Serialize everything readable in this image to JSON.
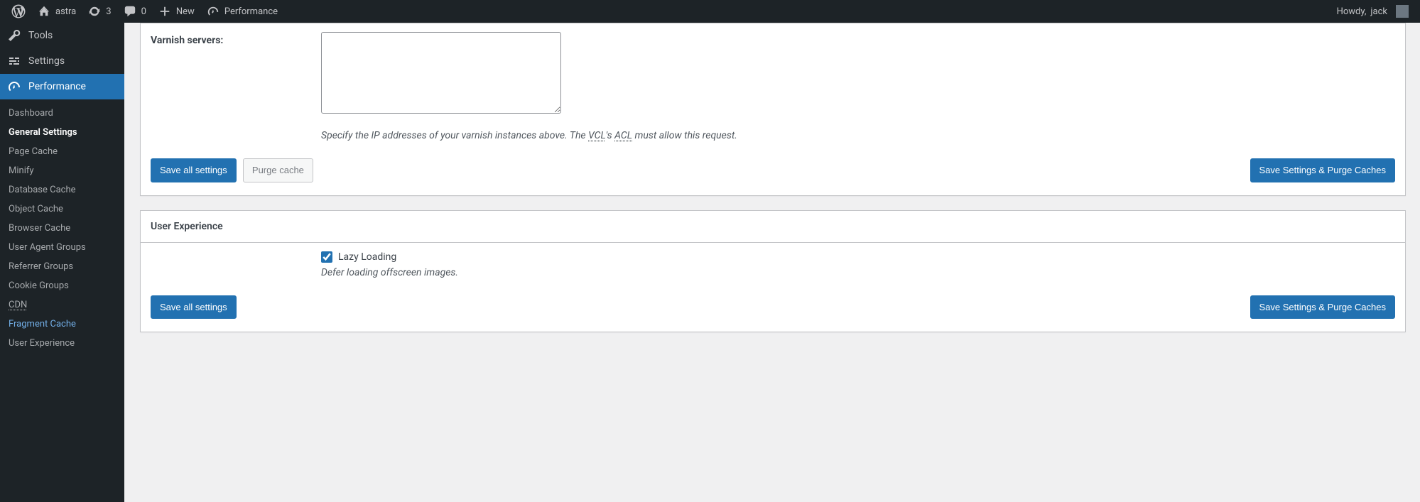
{
  "adminbar": {
    "site_name": "astra",
    "updates_count": "3",
    "comments_count": "0",
    "new_label": "New",
    "perf_label": "Performance",
    "howdy_prefix": "Howdy, ",
    "username": "jack"
  },
  "sidebar": {
    "items": [
      {
        "label": "Tools",
        "icon": "wrench"
      },
      {
        "label": "Settings",
        "icon": "sliders"
      },
      {
        "label": "Performance",
        "icon": "gauge",
        "current": true
      }
    ],
    "submenu": [
      {
        "label": "Dashboard"
      },
      {
        "label": "General Settings",
        "current": true
      },
      {
        "label": "Page Cache"
      },
      {
        "label": "Minify"
      },
      {
        "label": "Database Cache"
      },
      {
        "label": "Object Cache"
      },
      {
        "label": "Browser Cache"
      },
      {
        "label": "User Agent Groups"
      },
      {
        "label": "Referrer Groups"
      },
      {
        "label": "Cookie Groups"
      },
      {
        "label": "CDN",
        "dotted": true
      },
      {
        "label": "Fragment Cache",
        "highlight": true
      },
      {
        "label": "User Experience"
      }
    ]
  },
  "sections": {
    "varnish": {
      "label": "Varnish servers:",
      "textarea_value": "",
      "desc_prefix": "Specify the IP addresses of your varnish instances above. The ",
      "desc_abbr1": "VCL",
      "desc_mid": "'s ",
      "desc_abbr2": "ACL",
      "desc_suffix": " must allow this request."
    },
    "ux": {
      "title": "User Experience",
      "lazy_label": "Lazy Loading",
      "lazy_checked": true,
      "lazy_desc": "Defer loading offscreen images."
    }
  },
  "buttons": {
    "save_all": "Save all settings",
    "purge_cache": "Purge cache",
    "save_purge": "Save Settings & Purge Caches"
  }
}
